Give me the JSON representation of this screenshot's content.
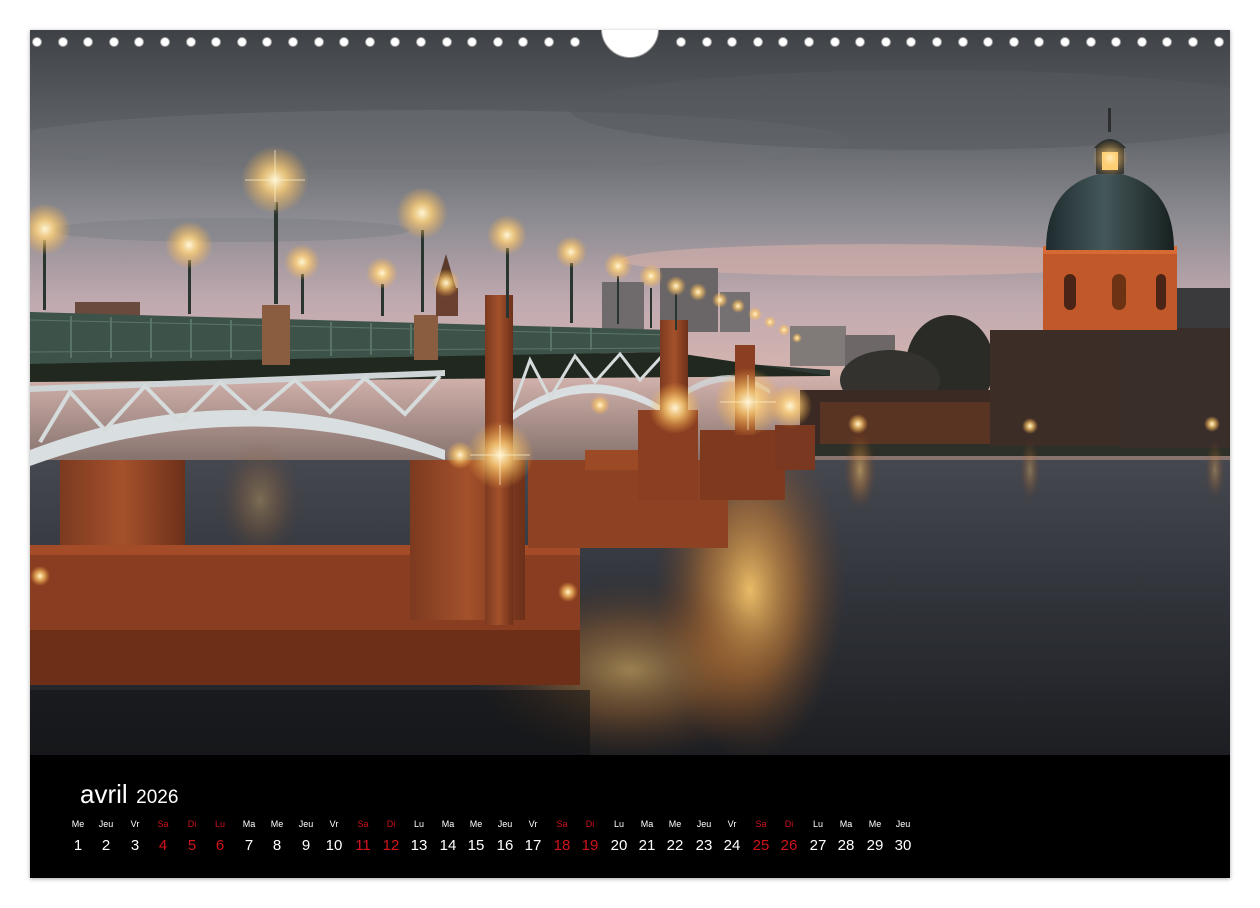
{
  "calendar": {
    "month": "avril",
    "year": "2026",
    "weekend_color": "#d2131b",
    "days": [
      {
        "wd": "Me",
        "n": "1",
        "we": false
      },
      {
        "wd": "Jeu",
        "n": "2",
        "we": false
      },
      {
        "wd": "Vr",
        "n": "3",
        "we": false
      },
      {
        "wd": "Sa",
        "n": "4",
        "we": true
      },
      {
        "wd": "Di",
        "n": "5",
        "we": true
      },
      {
        "wd": "Lu",
        "n": "6",
        "we": true
      },
      {
        "wd": "Ma",
        "n": "7",
        "we": false
      },
      {
        "wd": "Me",
        "n": "8",
        "we": false
      },
      {
        "wd": "Jeu",
        "n": "9",
        "we": false
      },
      {
        "wd": "Vr",
        "n": "10",
        "we": false
      },
      {
        "wd": "Sa",
        "n": "11",
        "we": true
      },
      {
        "wd": "Di",
        "n": "12",
        "we": true
      },
      {
        "wd": "Lu",
        "n": "13",
        "we": false
      },
      {
        "wd": "Ma",
        "n": "14",
        "we": false
      },
      {
        "wd": "Me",
        "n": "15",
        "we": false
      },
      {
        "wd": "Jeu",
        "n": "16",
        "we": false
      },
      {
        "wd": "Vr",
        "n": "17",
        "we": false
      },
      {
        "wd": "Sa",
        "n": "18",
        "we": true
      },
      {
        "wd": "Di",
        "n": "19",
        "we": true
      },
      {
        "wd": "Lu",
        "n": "20",
        "we": false
      },
      {
        "wd": "Ma",
        "n": "21",
        "we": false
      },
      {
        "wd": "Me",
        "n": "22",
        "we": false
      },
      {
        "wd": "Jeu",
        "n": "23",
        "we": false
      },
      {
        "wd": "Vr",
        "n": "24",
        "we": false
      },
      {
        "wd": "Sa",
        "n": "25",
        "we": true
      },
      {
        "wd": "Di",
        "n": "26",
        "we": true
      },
      {
        "wd": "Lu",
        "n": "27",
        "we": false
      },
      {
        "wd": "Ma",
        "n": "28",
        "we": false
      },
      {
        "wd": "Me",
        "n": "29",
        "we": false
      },
      {
        "wd": "Jeu",
        "n": "30",
        "we": false
      }
    ]
  }
}
